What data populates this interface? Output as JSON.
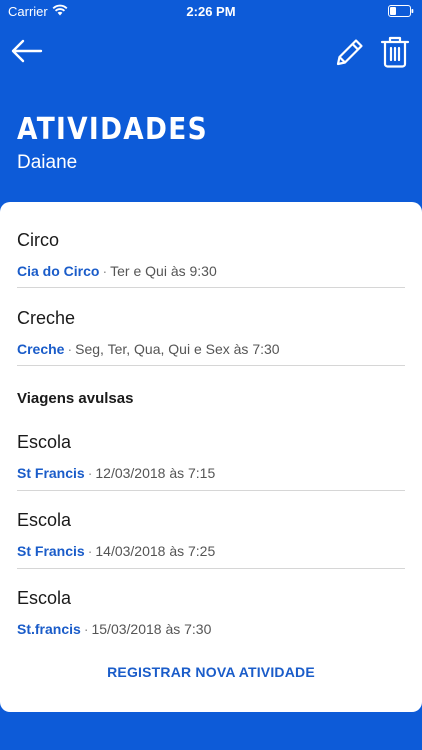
{
  "status_bar": {
    "carrier": "Carrier",
    "time": "2:26 PM"
  },
  "nav": {
    "back_icon": "arrow-left-icon",
    "edit_icon": "pencil-icon",
    "delete_icon": "trash-icon"
  },
  "header": {
    "title": "ATIVIDADES",
    "subtitle": "Daiane"
  },
  "activities": [
    {
      "title": "Circo",
      "place": "Cia do Circo",
      "schedule": "Ter e Qui às 9:30"
    },
    {
      "title": "Creche",
      "place": "Creche",
      "schedule": "Seg, Ter, Qua, Qui e Sex às 7:30"
    }
  ],
  "single_trips": {
    "header": "Viagens avulsas",
    "items": [
      {
        "title": "Escola",
        "place": "St Francis",
        "schedule": "12/03/2018 às 7:15"
      },
      {
        "title": "Escola",
        "place": "St Francis",
        "schedule": "14/03/2018 às 7:25"
      },
      {
        "title": "Escola",
        "place": "St.francis",
        "schedule": "15/03/2018 às 7:30"
      }
    ]
  },
  "register_button": "REGISTRAR NOVA ATIVIDADE",
  "colors": {
    "background": "#0d5bd8",
    "accent": "#1a5cc9",
    "card": "#ffffff"
  }
}
